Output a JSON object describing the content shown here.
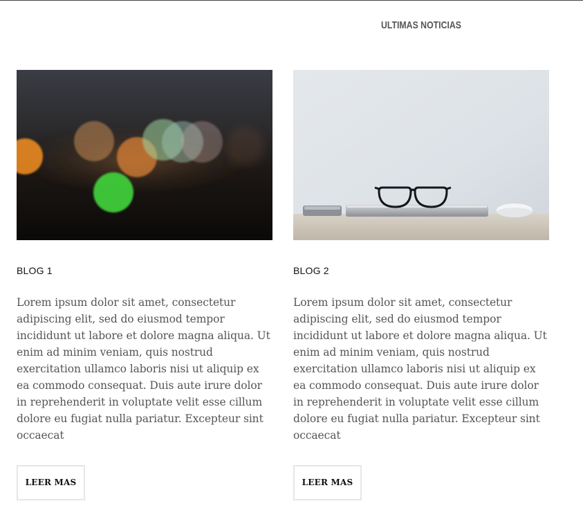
{
  "section": {
    "title": "ULTIMAS NOTICIAS"
  },
  "posts": [
    {
      "title": "BLOG 1",
      "body": "Lorem ipsum dolor sit amet, consectetur adipiscing elit, sed do eiusmod tempor incididunt ut labore et dolore magna aliqua. Ut enim ad minim veniam, quis nostrud exercitation ullamco laboris nisi ut aliquip ex ea commodo consequat. Duis aute irure dolor in reprehenderit in voluptate velit esse cillum dolore eu fugiat nulla pariatur. Excepteur sint occaecat",
      "button_label": "LEER MAS"
    },
    {
      "title": "BLOG 2",
      "body": "Lorem ipsum dolor sit amet, consectetur adipiscing elit, sed do eiusmod tempor incididunt ut labore et dolore magna aliqua. Ut enim ad minim veniam, quis nostrud exercitation ullamco laboris nisi ut aliquip ex ea commodo consequat. Duis aute irure dolor in reprehenderit in voluptate velit esse cillum dolore eu fugiat nulla pariatur. Excepteur sint occaecat",
      "button_label": "LEER MAS"
    }
  ]
}
